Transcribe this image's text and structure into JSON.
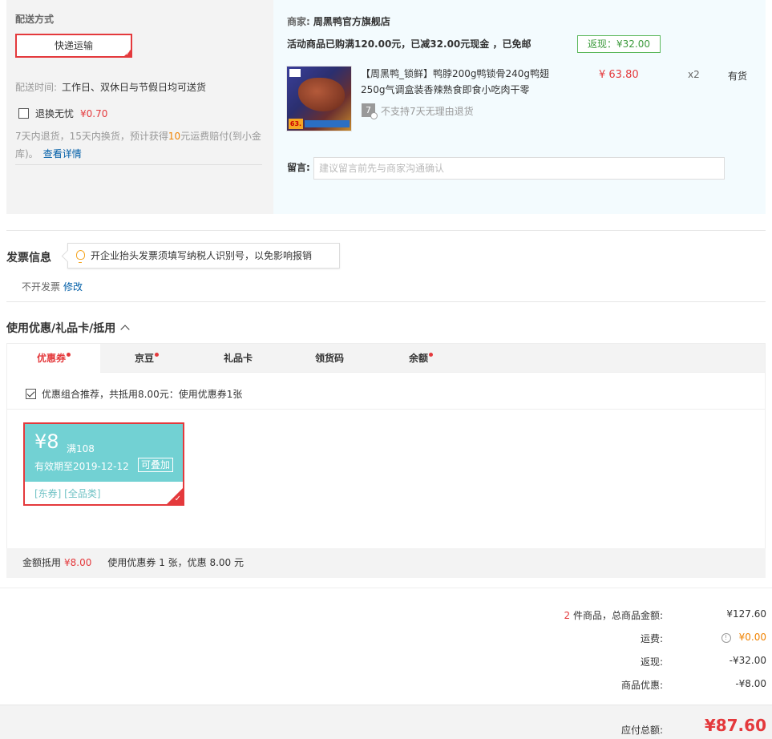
{
  "shipping": {
    "title": "配送方式",
    "method": "快递运输",
    "time_label": "配送时间:",
    "time_value": "工作日、双休日与节假日均可送货",
    "return_label": "退换无忧",
    "return_price": "¥0.70",
    "return_desc_a": "7天内退货，15天内换货，预计获得",
    "return_desc_num": "10",
    "return_desc_b": "元运费赔付(到小金库)。",
    "details_link": "查看详情"
  },
  "merchant": {
    "label": "商家:",
    "name": "周黑鸭官方旗舰店",
    "promo": "活动商品已购满120.00元，已减32.00元现金 ，已免邮",
    "cashback": "返现：¥32.00"
  },
  "product": {
    "name": "【周黑鸭_锁鲜】鸭脖200g鸭锁骨240g鸭翅250g气调盒装香辣熟食即食小吃肉干零",
    "price": "¥ 63.80",
    "qty": "x2",
    "stock": "有货",
    "no7_badge": "7",
    "no7_text": "不支持7天无理由退货",
    "img_tag": "63."
  },
  "message": {
    "label": "留言:",
    "placeholder": "建议留言前先与商家沟通确认"
  },
  "invoice": {
    "title": "发票信息",
    "tip": "开企业抬头发票须填写纳税人识别号，以免影响报销",
    "status": "不开发票",
    "edit": "修改"
  },
  "coupons": {
    "title": "使用优惠/礼品卡/抵用",
    "tabs": [
      {
        "label": "优惠券",
        "dot": true
      },
      {
        "label": "京豆",
        "dot": true
      },
      {
        "label": "礼品卡",
        "dot": false
      },
      {
        "label": "领货码",
        "dot": false
      },
      {
        "label": "余额",
        "dot": true
      }
    ],
    "combo_text": "优惠组合推荐，共抵用8.00元：使用优惠券1张",
    "card": {
      "amount": "¥8",
      "condition": "满108",
      "expiry": "有效期至2019-12-12",
      "stackable": "可叠加",
      "tags": "[东券]  [全品类]"
    },
    "summary_label": "金额抵用",
    "summary_amount": "¥8.00",
    "summary_text": "使用优惠券 1 张，优惠 8.00 元"
  },
  "totals": {
    "count": "2",
    "goods_label": " 件商品，总商品金额:",
    "goods_value": "¥127.60",
    "shipping_label": "运费:",
    "shipping_value": "¥0.00",
    "cashback_label": "返现:",
    "cashback_value": "-¥32.00",
    "discount_label": "商品优惠:",
    "discount_value": "-¥8.00",
    "payable_label": "应付总额:",
    "payable_value": "¥87.60"
  },
  "colors": {
    "accent_red": "#e4393c",
    "coupon_teal": "#72d1d3",
    "link_blue": "#005ea7"
  }
}
